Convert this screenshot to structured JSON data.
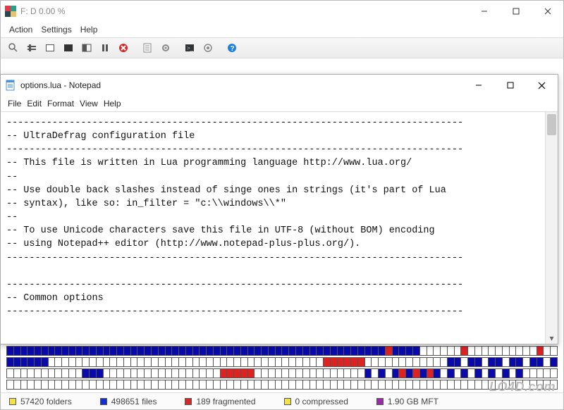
{
  "main": {
    "title": "F:  D  0.00 %",
    "menus": [
      "Action",
      "Settings",
      "Help"
    ],
    "toolbar_icons": [
      "magnifier-icon",
      "defrag-icon",
      "analyze-icon",
      "stop-icon",
      "report-icon",
      "pause-icon",
      "cancel-icon",
      "script-icon",
      "gear-icon",
      "terminal-icon",
      "cogwheel-icon",
      "help-icon"
    ],
    "status": {
      "folders": {
        "color": "#f2e24a",
        "label": "57420 folders"
      },
      "files": {
        "color": "#1431d6",
        "label": "498651 files"
      },
      "fragmented": {
        "color": "#d62828",
        "label": "189 fragmented"
      },
      "compressed": {
        "color": "#f2e24a",
        "label": "0 compressed"
      },
      "mft": {
        "color": "#9a2aa6",
        "label": "1.90 GB MFT"
      }
    }
  },
  "notepad": {
    "title": "options.lua - Notepad",
    "menus": [
      "File",
      "Edit",
      "Format",
      "View",
      "Help"
    ],
    "content": "--------------------------------------------------------------------------------\n-- UltraDefrag configuration file\n--------------------------------------------------------------------------------\n-- This file is written in Lua programming language http://www.lua.org/\n--\n-- Use double back slashes instead of singe ones in strings (it's part of Lua\n-- syntax), like so: in_filter = \"c:\\\\windows\\\\*\"\n--\n-- To use Unicode characters save this file in UTF-8 (without BOM) encoding\n-- using Notepad++ editor (http://www.notepad-plus-plus.org/).\n--------------------------------------------------------------------------------\n\n--------------------------------------------------------------------------------\n-- Common options\n--------------------------------------------------------------------------------"
  },
  "watermark": "LO4D.com"
}
